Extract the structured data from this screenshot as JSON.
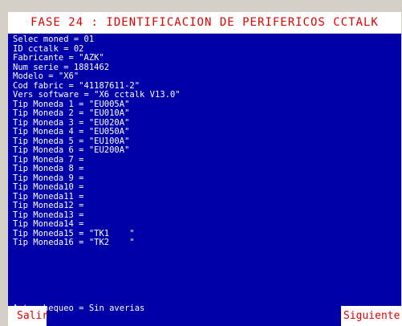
{
  "window": {
    "title": "FASE 24 : IDENTIFICACION DE PERIFERICOS CCTALK"
  },
  "info_lines": [
    "Selec moned = 01",
    "ID cctalk = 02",
    "Fabricante = \"AZK\"",
    "Num serie = 1881462",
    "Modelo = \"X6\"",
    "Cod fabric = \"41187611-2\"",
    "Vers software = \"X6 cctalk V13.0\"",
    "Tip Moneda 1 = \"EU005A\"",
    "Tip Moneda 2 = \"EU010A\"",
    "Tip Moneda 3 = \"EU020A\"",
    "Tip Moneda 4 = \"EU050A\"",
    "Tip Moneda 5 = \"EU100A\"",
    "Tip Moneda 6 = \"EU200A\"",
    "Tip Moneda 7 =",
    "Tip Moneda 8 =",
    "Tip Moneda 9 =",
    "Tip Moneda10 =",
    "Tip Moneda11 =",
    "Tip Moneda12 =",
    "Tip Moneda13 =",
    "Tip Moneda14 =",
    "Tip Moneda15 = \"TK1    \"",
    "Tip Moneda16 = \"TK2    \""
  ],
  "status": {
    "autocheck": "Auto chequeo = Sin averias"
  },
  "buttons": {
    "exit_label": "Salir",
    "next_label": "Siguiente"
  },
  "colors": {
    "screen_bg": "#0000a8",
    "text": "#ffffff",
    "accent_red": "#e00000",
    "frame": "#d4d0c8"
  }
}
